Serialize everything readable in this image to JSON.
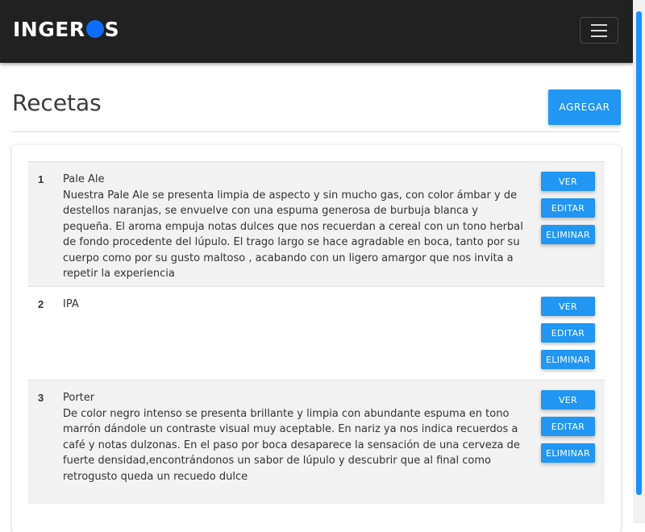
{
  "navbar": {
    "brand_left": "INGER",
    "brand_right": "S"
  },
  "page": {
    "title": "Recetas",
    "add_label": "AGREGAR"
  },
  "actions": {
    "view": "VER",
    "edit": "EDITAR",
    "delete": "ELIMINAR"
  },
  "recipes": [
    {
      "number": "1",
      "name": "Pale Ale",
      "description": "Nuestra Pale Ale se presenta limpia de aspecto y sin mucho gas, con color ámbar y de destellos naranjas, se envuelve con una espuma generosa de burbuja blanca y pequeña. El aroma empuja notas dulces que nos recuerdan a cereal con un tono herbal de fondo procedente del lúpulo. El trago largo se hace agradable en boca, tanto por su cuerpo como por su gusto maltoso , acabando con un ligero amargor que nos invita a repetir la experiencia"
    },
    {
      "number": "2",
      "name": "IPA",
      "description": ""
    },
    {
      "number": "3",
      "name": "Porter",
      "description": "De color negro intenso se presenta brillante y limpia con abundante espuma en tono marrón dándole un contraste visual muy aceptable. En nariz ya nos indica recuerdos a café y notas dulzonas. En el paso por boca desaparece la sensación de una cerveza de fuerte densidad,encontrándonos un sabor de lúpulo y descubrir que al final como retrogusto queda un recuedo dulce"
    }
  ]
}
